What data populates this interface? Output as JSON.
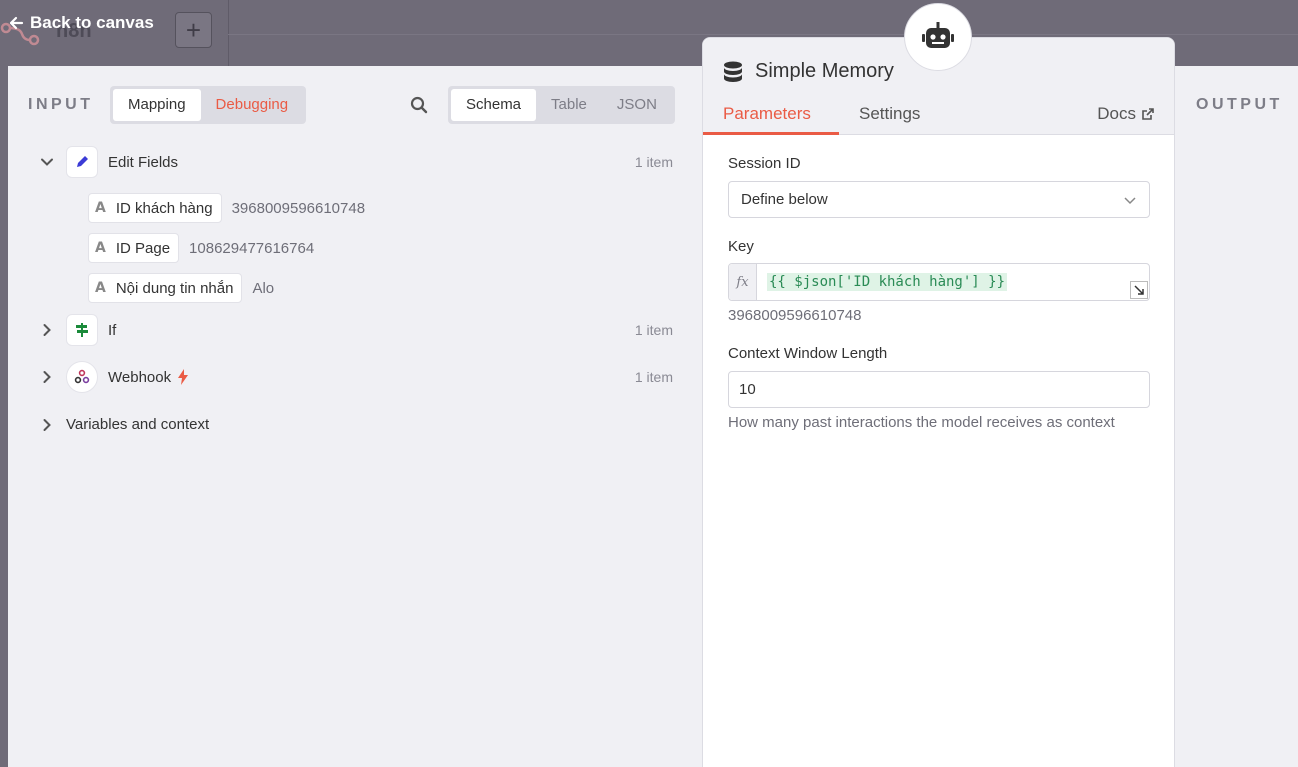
{
  "topbar": {
    "back_label": "Back to canvas",
    "ghost_title": "n8n",
    "add_label": "+"
  },
  "input": {
    "label": "INPUT",
    "mode_options": [
      "Mapping",
      "Debugging"
    ],
    "view_options": [
      "Schema",
      "Table",
      "JSON"
    ],
    "nodes": [
      {
        "name": "Edit Fields",
        "count": "1 item",
        "icon": "pencil-icon",
        "fields": [
          {
            "name": "ID khách hàng",
            "value": "3968009596610748"
          },
          {
            "name": "ID Page",
            "value": "108629477616764"
          },
          {
            "name": "Nội dung tin nhắn",
            "value": "Alo"
          }
        ]
      },
      {
        "name": "If",
        "count": "1 item",
        "icon": "if-signpost-icon"
      },
      {
        "name": "Webhook",
        "count": "1 item",
        "icon": "webhook-icon"
      }
    ],
    "variables_label": "Variables and context"
  },
  "node_panel": {
    "title": "Simple Memory",
    "tabs": [
      "Parameters",
      "Settings"
    ],
    "docs_label": "Docs",
    "session_label": "Session ID",
    "session_value": "Define below",
    "key_label": "Key",
    "fx_label": "fx",
    "key_expression": "{{ $json['ID khách hàng'] }}",
    "key_result": "3968009596610748",
    "cwl_label": "Context Window Length",
    "cwl_value": "10",
    "cwl_hint": "How many past interactions the model receives as context"
  },
  "output": {
    "label": "OUTPUT"
  },
  "colors": {
    "accent": "#ea5b45",
    "expr_green": "#2a8b55",
    "expr_bg": "#dff3e6"
  }
}
